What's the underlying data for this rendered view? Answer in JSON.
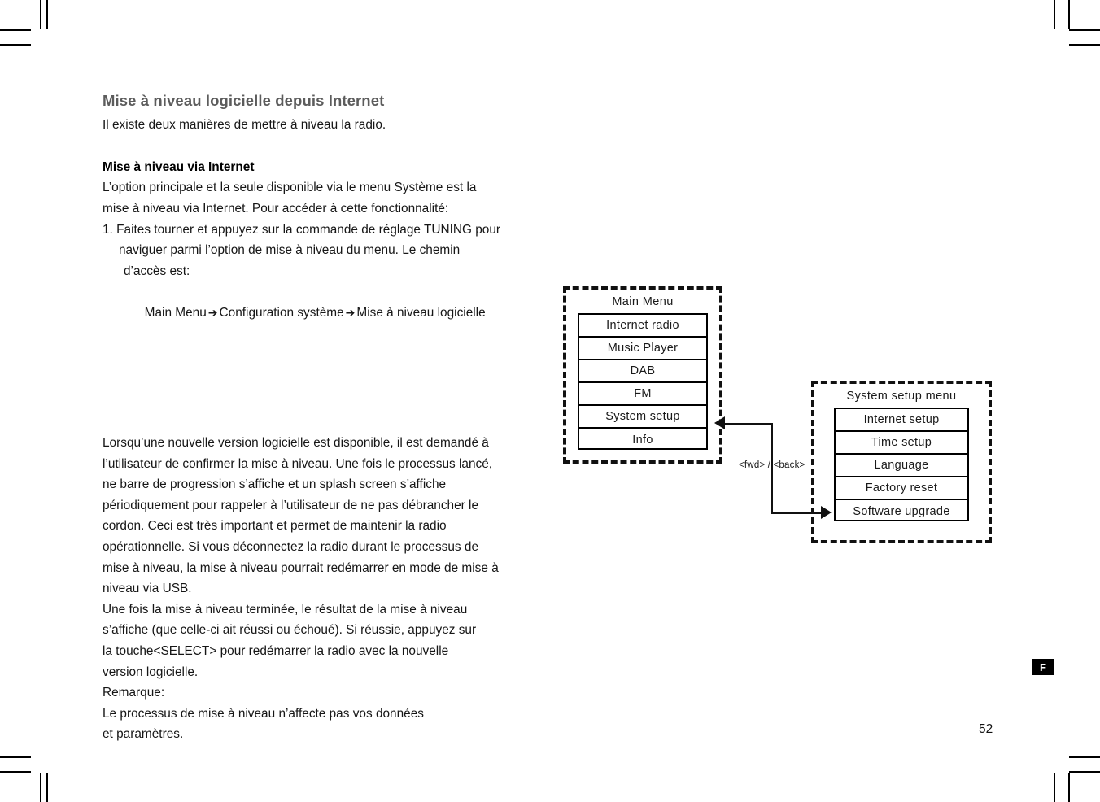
{
  "document": {
    "page_number": "52",
    "language_badge": "F",
    "title": "Mise à niveau logicielle depuis Internet",
    "intro": "Il existe deux manières de mettre à niveau la radio.",
    "subheading": "Mise à niveau via Internet",
    "para_1_line_1": "L’option principale et la seule disponible via le menu Système est la",
    "para_1_line_2": "mise à niveau via Internet. Pour accéder à cette fonctionnalité:",
    "step_1_line_1": "1. Faites tourner et appuyez sur la commande de réglage TUNING pour",
    "step_1_line_2": "naviguer parmi l’option de mise à niveau du menu. Le chemin",
    "step_1_line_3": "d’accès est:",
    "path": {
      "node_1": "Main Menu",
      "arrow_1": "➔",
      "node_2": "Configuration système",
      "arrow_2": "➔",
      "node_3": "Mise à niveau logicielle"
    },
    "para_2": "Lorsqu’une nouvelle version logicielle est disponible, il est demandé à\nl’utilisateur de confirmer la mise à niveau. Une fois le processus lancé,\nne barre de progression s’affiche et un splash screen s’affiche\npériodiquement pour rappeler à l’utilisateur de ne pas débrancher le\ncordon. Ceci est très important et permet de maintenir la radio\nopérationnelle. Si vous déconnectez la radio durant le processus de\nmise à niveau, la mise à niveau pourrait redémarrer en mode de mise à\nniveau via USB.",
    "para_3": "Une fois la mise à niveau terminée, le résultat de la mise à niveau\ns’affiche (que celle-ci ait réussi ou échoué). Si réussie, appuyez sur\nla touche<SELECT> pour redémarrer la radio avec la nouvelle\nversion logicielle.",
    "remark_label": "Remarque:",
    "remark_text": "Le processus de mise à niveau n’affecte pas vos données\net paramètres."
  },
  "diagram": {
    "main_menu": {
      "title": "Main Menu",
      "items": [
        "Internet radio",
        "Music Player",
        "DAB",
        "FM",
        "System setup",
        "Info"
      ]
    },
    "system_setup_menu": {
      "title": "System setup menu",
      "items": [
        "Internet setup",
        "Time setup",
        "Language",
        "Factory reset",
        "Software upgrade"
      ]
    },
    "connector_label": "<fwd> / <back>"
  },
  "colors": {
    "title_gray": "#5c5c5c",
    "body_black": "#161616",
    "rule_black": "#111111"
  }
}
